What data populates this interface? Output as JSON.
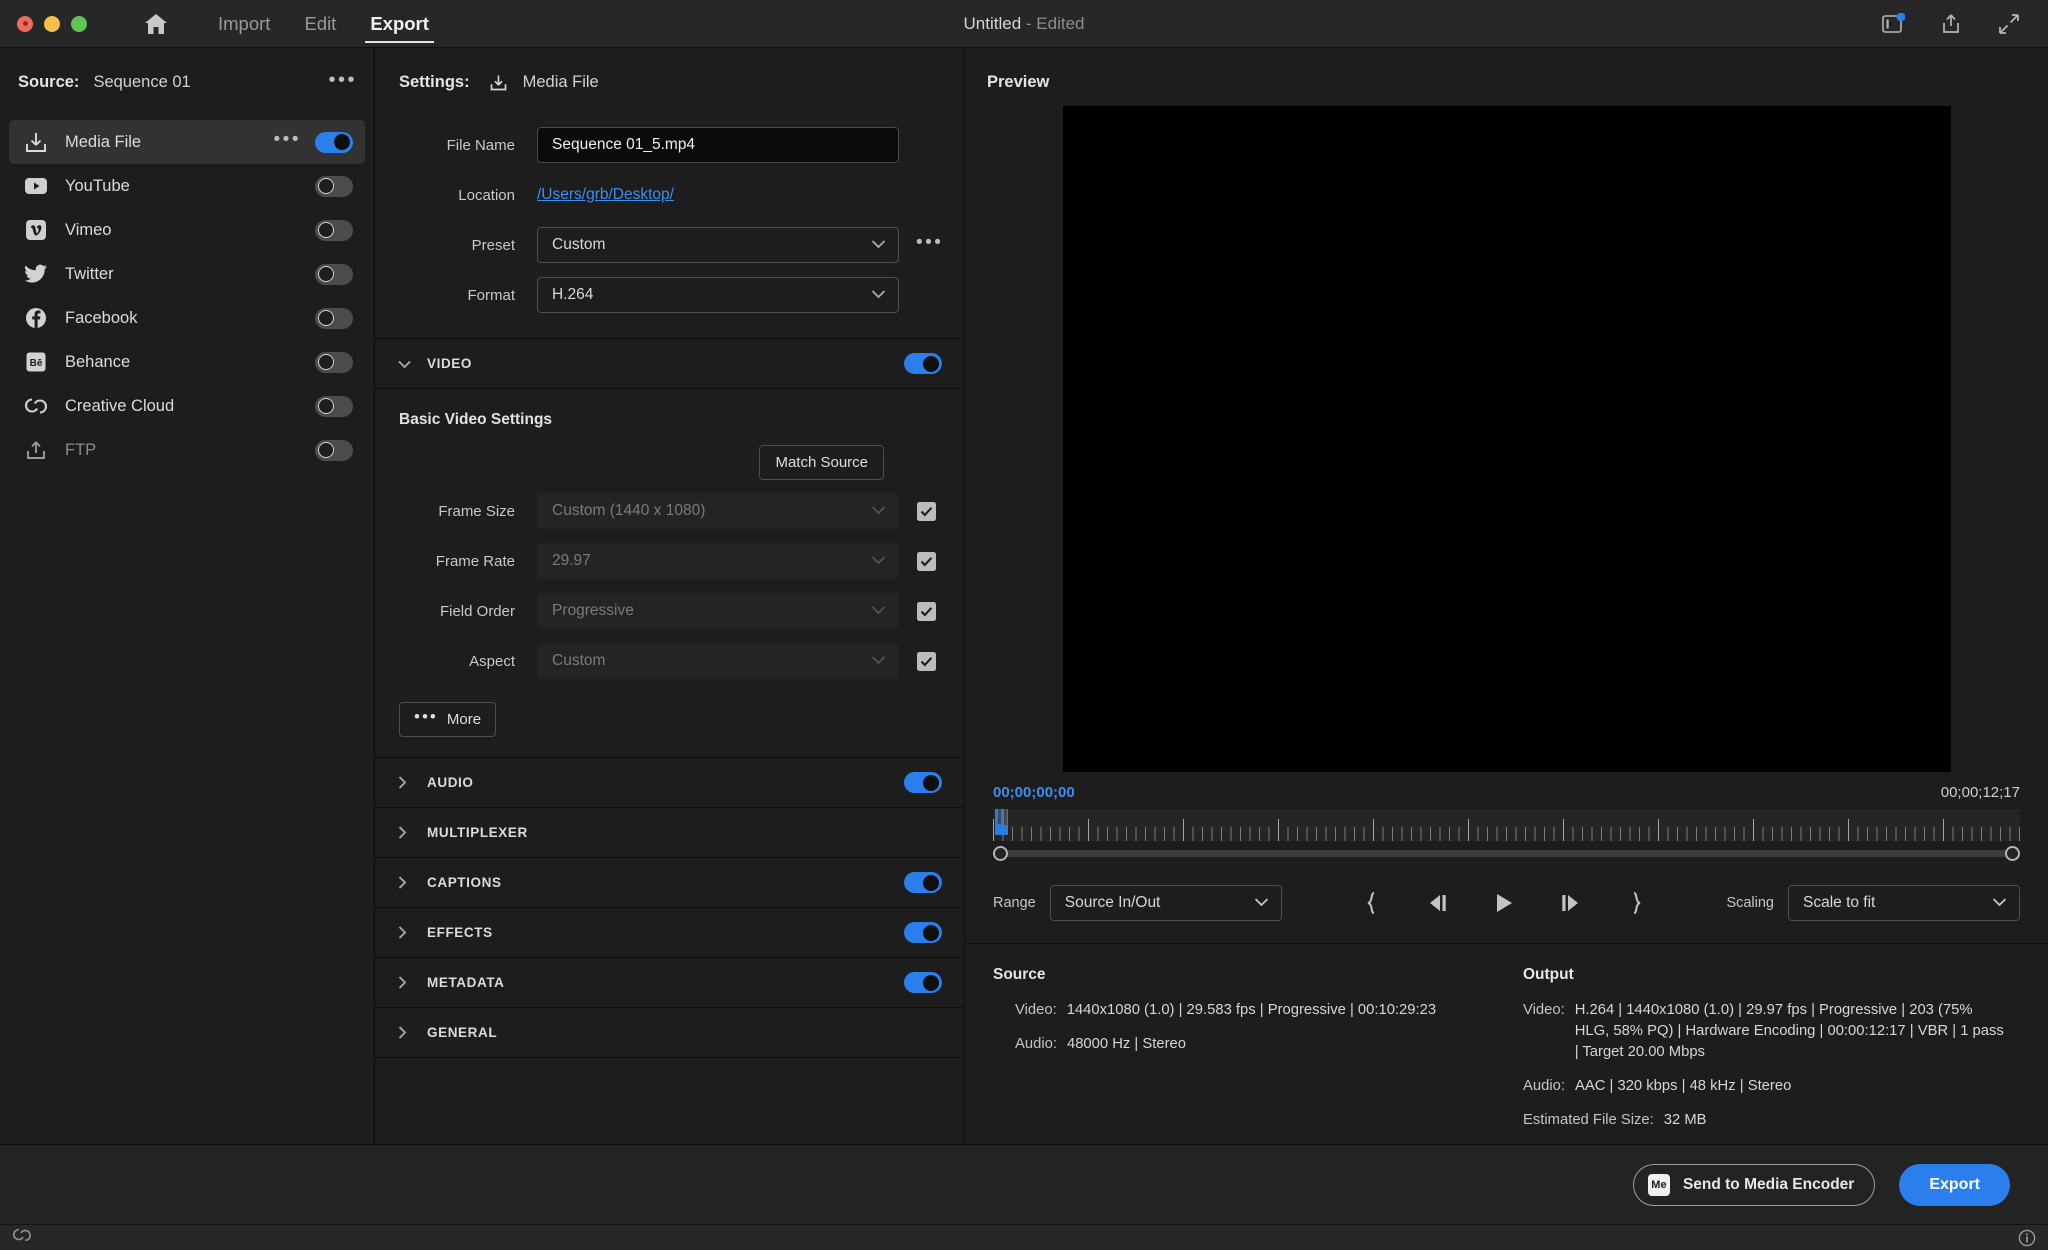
{
  "titlebar": {
    "window_controls": [
      "close",
      "minimize",
      "maximize"
    ],
    "home_icon": "home-icon",
    "tabs": [
      {
        "label": "Import",
        "active": false
      },
      {
        "label": "Edit",
        "active": false
      },
      {
        "label": "Export",
        "active": true
      }
    ],
    "document_name": "Untitled",
    "document_state": "- Edited",
    "right_icons": [
      "panel-notification-icon",
      "share-icon",
      "fullscreen-icon"
    ]
  },
  "sidebar": {
    "source_label": "Source:",
    "source_value": "Sequence 01",
    "overflow_label": "•••",
    "destinations": [
      {
        "label": "Media File",
        "icon": "media-file-icon",
        "enabled": true,
        "selected": true,
        "has_overflow": true
      },
      {
        "label": "YouTube",
        "icon": "youtube-icon",
        "enabled": false,
        "selected": false,
        "has_overflow": false
      },
      {
        "label": "Vimeo",
        "icon": "vimeo-icon",
        "enabled": false,
        "selected": false,
        "has_overflow": false
      },
      {
        "label": "Twitter",
        "icon": "twitter-icon",
        "enabled": false,
        "selected": false,
        "has_overflow": false
      },
      {
        "label": "Facebook",
        "icon": "facebook-icon",
        "enabled": false,
        "selected": false,
        "has_overflow": false
      },
      {
        "label": "Behance",
        "icon": "behance-icon",
        "enabled": false,
        "selected": false,
        "has_overflow": false
      },
      {
        "label": "Creative Cloud",
        "icon": "creative-cloud-icon",
        "enabled": false,
        "selected": false,
        "has_overflow": false
      },
      {
        "label": "FTP",
        "icon": "ftp-upload-icon",
        "enabled": false,
        "selected": false,
        "dimmed": true,
        "has_overflow": false
      }
    ]
  },
  "settings": {
    "header_label": "Settings:",
    "header_icon": "media-file-icon",
    "header_value": "Media File",
    "file_name": {
      "label": "File Name",
      "value": "Sequence 01_5.mp4"
    },
    "location": {
      "label": "Location",
      "value": "/Users/grb/Desktop/"
    },
    "preset": {
      "label": "Preset",
      "value": "Custom",
      "overflow": "•••"
    },
    "format": {
      "label": "Format",
      "value": "H.264"
    },
    "video_section": {
      "title": "VIDEO",
      "expanded": true,
      "enabled": true,
      "subheading": "Basic Video Settings",
      "match_source_label": "Match Source",
      "fields": [
        {
          "label": "Frame Size",
          "value": "Custom (1440 x 1080)",
          "disabled": true,
          "checked": true
        },
        {
          "label": "Frame Rate",
          "value": "29.97",
          "disabled": true,
          "checked": true
        },
        {
          "label": "Field Order",
          "value": "Progressive",
          "disabled": true,
          "checked": true
        },
        {
          "label": "Aspect",
          "value": "Custom",
          "disabled": true,
          "checked": true
        }
      ],
      "more_label": "More"
    },
    "sections": [
      {
        "title": "AUDIO",
        "expanded": false,
        "has_toggle": true,
        "enabled": true
      },
      {
        "title": "MULTIPLEXER",
        "expanded": false,
        "has_toggle": false,
        "enabled": false
      },
      {
        "title": "CAPTIONS",
        "expanded": false,
        "has_toggle": true,
        "enabled": true
      },
      {
        "title": "EFFECTS",
        "expanded": false,
        "has_toggle": true,
        "enabled": true
      },
      {
        "title": "METADATA",
        "expanded": false,
        "has_toggle": true,
        "enabled": true
      },
      {
        "title": "GENERAL",
        "expanded": false,
        "has_toggle": false,
        "enabled": false
      }
    ]
  },
  "preview": {
    "title": "Preview",
    "timecode_current": "00;00;00;00",
    "timecode_duration": "00;00;12;17",
    "range": {
      "label": "Range",
      "value": "Source In/Out"
    },
    "scaling": {
      "label": "Scaling",
      "value": "Scale to fit"
    },
    "transport_icons": [
      "mark-in-icon",
      "step-back-icon",
      "play-icon",
      "step-forward-icon",
      "mark-out-icon"
    ]
  },
  "info": {
    "source": {
      "title": "Source",
      "video_key": "Video:",
      "video_value": "1440x1080 (1.0) | 29.583 fps | Progressive | 00:10:29:23",
      "audio_key": "Audio:",
      "audio_value": "48000 Hz | Stereo"
    },
    "output": {
      "title": "Output",
      "video_key": "Video:",
      "video_value": "H.264 | 1440x1080 (1.0) | 29.97 fps | Progressive | 203 (75% HLG, 58% PQ) | Hardware Encoding | 00:00:12:17 | VBR | 1 pass | Target 20.00 Mbps",
      "audio_key": "Audio:",
      "audio_value": "AAC | 320 kbps | 48 kHz | Stereo",
      "size_key": "Estimated File Size:",
      "size_value": "32 MB"
    }
  },
  "footer": {
    "media_encoder_badge": "Me",
    "media_encoder_label": "Send to Media Encoder",
    "export_label": "Export"
  },
  "statusbar": {
    "left_icon": "creative-cloud-icon",
    "right_icon": "info-icon"
  },
  "colors": {
    "accent": "#2a7fec",
    "link": "#3b8ff0",
    "panel": "#1d1d1d",
    "titlebar": "#272727"
  }
}
